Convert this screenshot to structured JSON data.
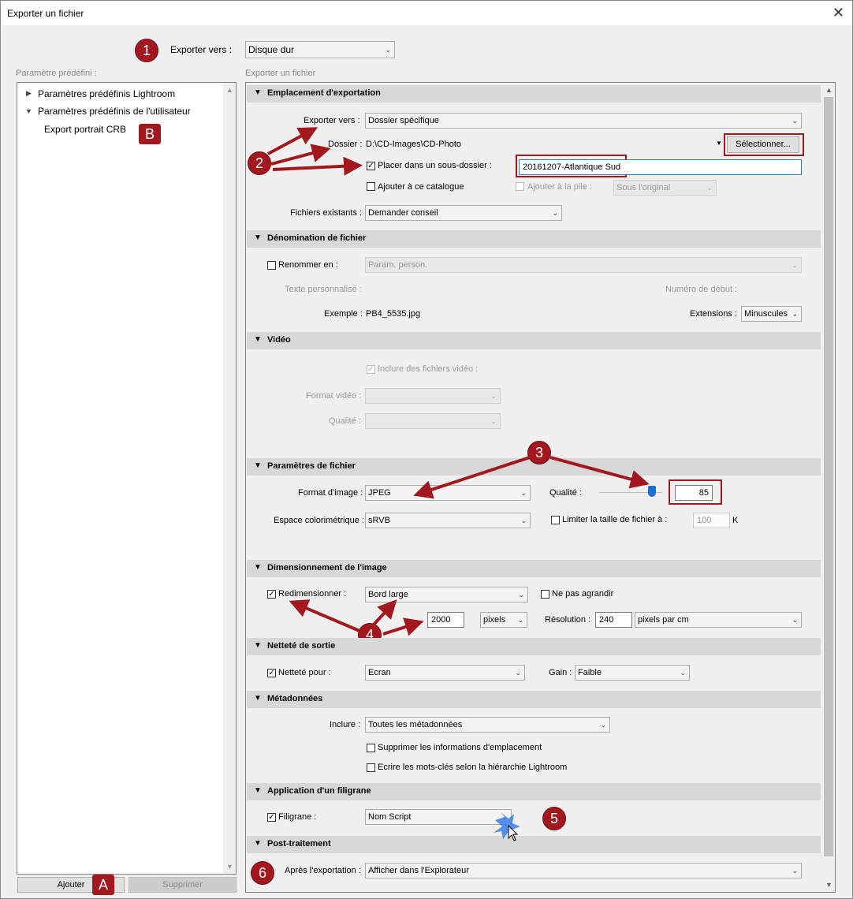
{
  "window": {
    "title": "Exporter un fichier"
  },
  "top": {
    "export_to_label": "Exporter vers :",
    "export_to_value": "Disque dur"
  },
  "presets": {
    "label": "Paramètre prédéfini :",
    "items": [
      {
        "label": "Paramètres prédéfinis Lightroom"
      },
      {
        "label": "Paramètres prédéfinis de l'utilisateur"
      },
      {
        "label": "Export portrait CRB"
      }
    ],
    "add_button": "Ajouter",
    "remove_button": "Supprimer"
  },
  "main_label": "Exporter un fichier",
  "sections": {
    "location": {
      "title": "Emplacement d'exportation",
      "export_to_label": "Exporter vers :",
      "export_to_value": "Dossier spécifique",
      "folder_label": "Dossier :",
      "folder_value": "D:\\CD-Images\\CD-Photo",
      "select_button": "Sélectionner...",
      "subfolder_label": "Placer dans un sous-dossier :",
      "subfolder_value": "20161207-Atlantique Sud",
      "add_catalog_label": "Ajouter à ce catalogue",
      "add_stack_label": "Ajouter à la pile :",
      "stack_value": "Sous l'original",
      "existing_label": "Fichiers existants :",
      "existing_value": "Demander conseil"
    },
    "naming": {
      "title": "Dénomination de fichier",
      "rename_label": "Renommer en :",
      "rename_value": "Param. person.",
      "custom_text_label": "Texte personnalisé :",
      "start_number_label": "Numéro de début :",
      "example_label": "Exemple :",
      "example_value": "PB4_5535.jpg",
      "extensions_label": "Extensions :",
      "extensions_value": "Minuscules"
    },
    "video": {
      "title": "Vidéo",
      "include_label": "Inclure des fichiers vidéo :",
      "format_label": "Format vidéo :",
      "quality_label": "Qualité :"
    },
    "file": {
      "title": "Paramètres de fichier",
      "format_label": "Format d'image :",
      "format_value": "JPEG",
      "quality_label": "Qualité :",
      "quality_value": "85",
      "colorspace_label": "Espace colorimétrique :",
      "colorspace_value": "sRVB",
      "limit_label": "Limiter la taille de fichier à :",
      "limit_value": "100",
      "limit_unit": "K"
    },
    "sizing": {
      "title": "Dimensionnement de l'image",
      "resize_label": "Redimensionner :",
      "resize_value": "Bord large",
      "no_enlarge_label": "Ne pas agrandir",
      "size_value": "2000",
      "size_unit": "pixels",
      "resolution_label": "Résolution :",
      "resolution_value": "240",
      "resolution_unit": "pixels par cm"
    },
    "sharpening": {
      "title": "Netteté de sortie",
      "sharpen_label": "Netteté pour :",
      "sharpen_value": "Ecran",
      "gain_label": "Gain :",
      "gain_value": "Faible"
    },
    "metadata": {
      "title": "Métadonnées",
      "include_label": "Inclure :",
      "include_value": "Toutes les métadonnées",
      "remove_location_label": "Supprimer les informations d'emplacement",
      "keywords_label": "Ecrire les mots-clés selon la hiérarchie Lightroom"
    },
    "watermark": {
      "title": "Application d'un filigrane",
      "watermark_label": "Filigrane :",
      "watermark_value": "Nom Script"
    },
    "post": {
      "title": "Post-traitement",
      "after_label": "Après l'exportation :",
      "after_value": "Afficher dans l'Explorateur"
    }
  },
  "annotations": {
    "n1": "1",
    "n2": "2",
    "n3": "3",
    "n4": "4",
    "n5": "5",
    "n6": "6",
    "a": "A",
    "b": "B"
  },
  "colors": {
    "annotation": "#a3181e",
    "section_header": "#d8d8d8",
    "slider_thumb": "#1e6fd0"
  }
}
